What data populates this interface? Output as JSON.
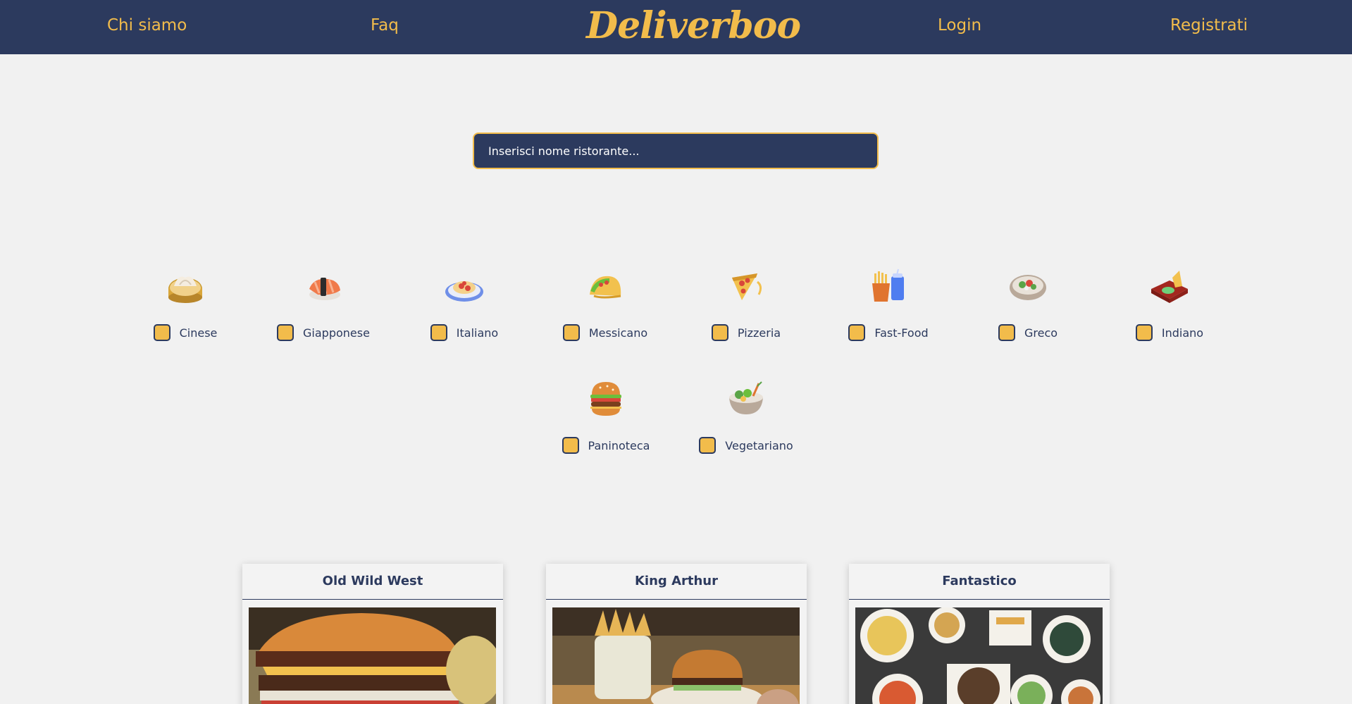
{
  "nav": {
    "chi_siamo": "Chi siamo",
    "faq": "Faq",
    "logo": "Deliverboo",
    "login": "Login",
    "registrati": "Registrati"
  },
  "search": {
    "placeholder": "Inserisci nome ristorante..."
  },
  "categories": [
    {
      "label": "Cinese",
      "icon": "dim-sum-icon",
      "checked": false
    },
    {
      "label": "Giapponese",
      "icon": "sushi-icon",
      "checked": false
    },
    {
      "label": "Italiano",
      "icon": "pasta-plate-icon",
      "checked": false
    },
    {
      "label": "Messicano",
      "icon": "taco-icon",
      "checked": false
    },
    {
      "label": "Pizzeria",
      "icon": "pizza-icon",
      "checked": false
    },
    {
      "label": "Fast-Food",
      "icon": "fries-drink-icon",
      "checked": false
    },
    {
      "label": "Greco",
      "icon": "greek-bowl-icon",
      "checked": false
    },
    {
      "label": "Indiano",
      "icon": "indian-dish-icon",
      "checked": false
    },
    {
      "label": "Paninoteca",
      "icon": "burger-icon",
      "checked": false
    },
    {
      "label": "Vegetariano",
      "icon": "salad-bowl-icon",
      "checked": false
    }
  ],
  "restaurants": [
    {
      "name": "Old Wild West",
      "image": "burger-photo"
    },
    {
      "name": "King Arthur",
      "image": "burger-fries-photo"
    },
    {
      "name": "Fantastico",
      "image": "chinese-dishes-photo"
    }
  ],
  "colors": {
    "primary": "#2c3a5e",
    "accent": "#f2bc4b",
    "background": "#f1f1f1"
  }
}
